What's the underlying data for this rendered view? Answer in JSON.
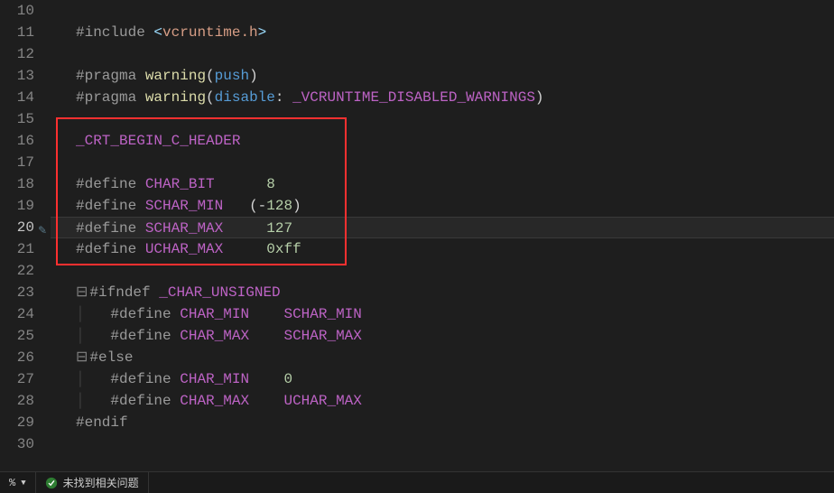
{
  "gutter": {
    "start": 10,
    "end": 30,
    "current": 20
  },
  "code": {
    "l11": {
      "dir": "#include",
      "open": "<",
      "hdr": "vcruntime.h",
      "close": ">"
    },
    "l13": {
      "dir": "#pragma",
      "fn": "warning",
      "arg": "push"
    },
    "l14": {
      "dir": "#pragma",
      "fn": "warning",
      "kw": "disable",
      "macro": "_VCRUNTIME_DISABLED_WARNINGS"
    },
    "l16": {
      "macro": "_CRT_BEGIN_C_HEADER"
    },
    "l18": {
      "dir": "#define",
      "name": "CHAR_BIT",
      "val": "8"
    },
    "l19": {
      "dir": "#define",
      "name": "SCHAR_MIN",
      "open": "(",
      "neg": "-",
      "val": "128",
      "close": ")"
    },
    "l20": {
      "dir": "#define",
      "name": "SCHAR_MAX",
      "val": "127"
    },
    "l21": {
      "dir": "#define",
      "name": "UCHAR_MAX",
      "val": "0xff"
    },
    "l23": {
      "dir": "#ifndef",
      "macro": "_CHAR_UNSIGNED"
    },
    "l24": {
      "dir": "#define",
      "name": "CHAR_MIN",
      "val": "SCHAR_MIN"
    },
    "l25": {
      "dir": "#define",
      "name": "CHAR_MAX",
      "val": "SCHAR_MAX"
    },
    "l26": {
      "dir": "#else"
    },
    "l27": {
      "dir": "#define",
      "name": "CHAR_MIN",
      "val": "0"
    },
    "l28": {
      "dir": "#define",
      "name": "CHAR_MAX",
      "val": "UCHAR_MAX"
    },
    "l29": {
      "dir": "#endif"
    }
  },
  "statusbar": {
    "left_pct": "%",
    "no_issues": "未找到相关问题"
  }
}
